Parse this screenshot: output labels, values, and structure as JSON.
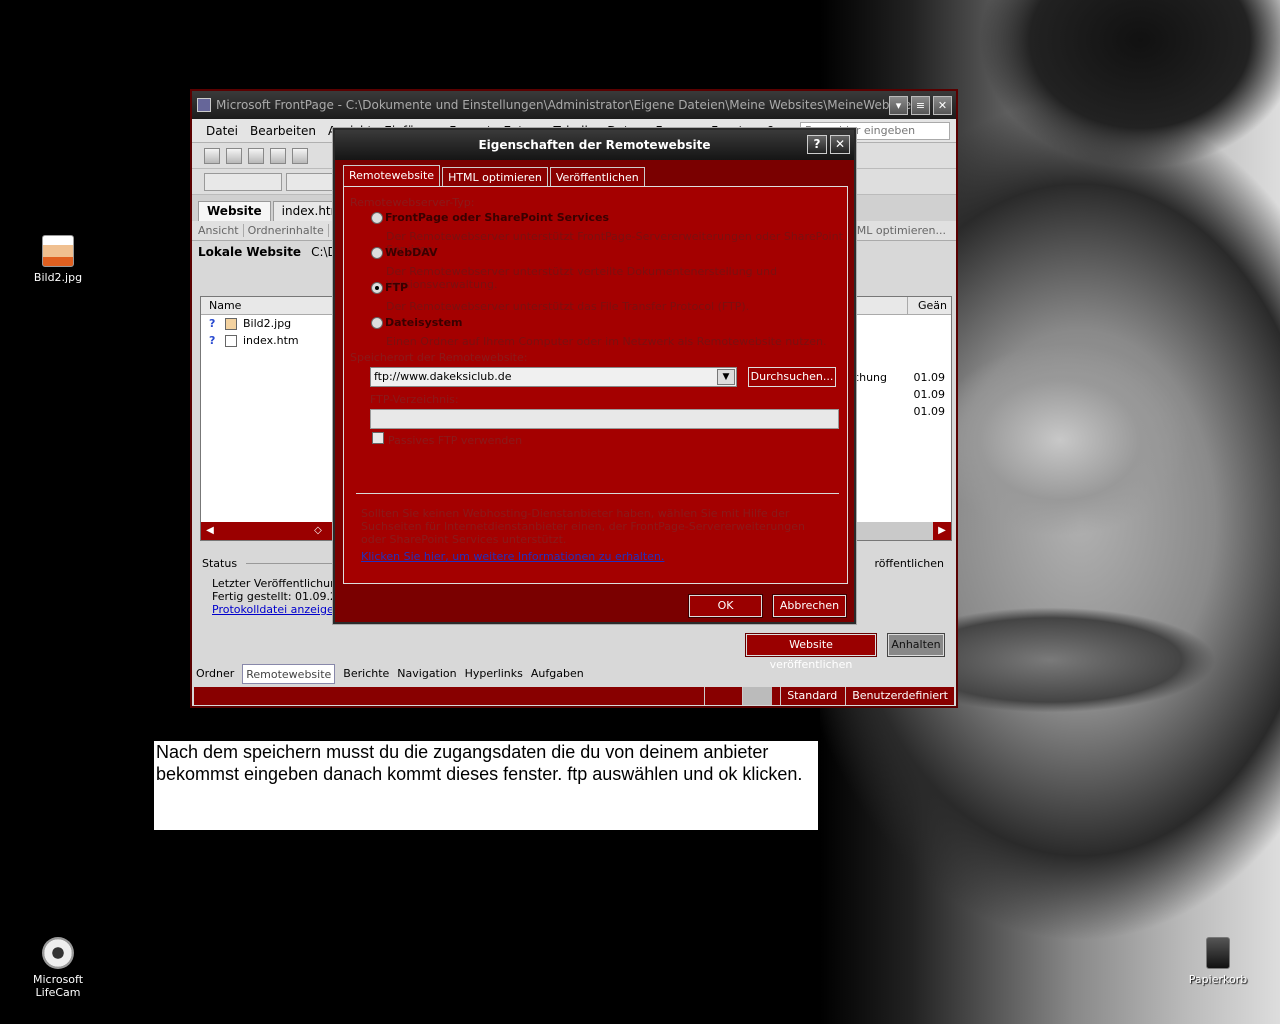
{
  "desktop": {
    "icons": [
      {
        "label": "Bild2.jpg"
      },
      {
        "label": "Microsoft LifeCam"
      },
      {
        "label": "Papierkorb"
      }
    ]
  },
  "frontpage": {
    "title": "Microsoft FrontPage - C:\\Dokumente und Einstellungen\\Administrator\\Eigene Dateien\\Meine Websites\\MeineWebsite",
    "menu": [
      "Datei",
      "Bearbeiten",
      "Ansicht",
      "Einfügen",
      "Format",
      "Extras",
      "Tabelle",
      "Daten",
      "Frames",
      "Fenster",
      "?"
    ],
    "help_placeholder": "Frage hier eingeben",
    "tabs": [
      "Website",
      "index.htm"
    ],
    "view_bar": [
      "Ansicht",
      "Ordnerinhalte",
      "HTML optimieren..."
    ],
    "local_site_label": "Lokale Website",
    "local_site_path": "C:\\Dokumente...",
    "file_header_name": "Name",
    "file_header_right": "Geän",
    "files": [
      {
        "status": "?",
        "name": "Bild2.jpg"
      },
      {
        "status": "?",
        "name": "index.htm"
      }
    ],
    "right_values": [
      "echung",
      "01.09",
      "01.09",
      "01.09"
    ],
    "status_title": "Status",
    "status_lines": [
      "Letzter Veröffentlichungsst",
      "Fertig gestellt: 01.09.200"
    ],
    "log_link": "Protokolldatei anzeigen",
    "publish_label": "röffentlichen",
    "publish_button": "Website veröffentlichen",
    "stop_button": "Anhalten",
    "view_switch": [
      "Ordner",
      "Remotewebsite",
      "Berichte",
      "Navigation",
      "Hyperlinks",
      "Aufgaben"
    ],
    "statusbar": [
      "Standard",
      "Benutzerdefiniert"
    ],
    "window_buttons": [
      "▾",
      "≡",
      "✕"
    ]
  },
  "dialog": {
    "title": "Eigenschaften der Remotewebsite",
    "title_buttons": [
      "?",
      "✕"
    ],
    "tabs": [
      "Remotewebsite",
      "HTML optimieren",
      "Veröffentlichen"
    ],
    "server_type_label": "Remotewebserver-Typ:",
    "options": [
      {
        "label": "FrontPage oder SharePoint Services",
        "desc": "Der Remotewebserver unterstützt FrontPage-Servererweiterungen oder SharePoint Services.",
        "checked": false
      },
      {
        "label": "WebDAV",
        "desc": "Der Remotewebserver unterstützt verteilte Dokumentenerstellung und Versionsverwaltung.",
        "checked": false
      },
      {
        "label": "FTP",
        "desc": "Der Remotewebserver unterstützt das File Transfer Protocol (FTP).",
        "checked": true
      },
      {
        "label": "Dateisystem",
        "desc": "Einen Ordner auf Ihrem Computer oder im Netzwerk als Remotewebsite nutzen.",
        "checked": false
      }
    ],
    "location_label": "Speicherort der Remotewebsite:",
    "location_value": "ftp://www.dakeksiclub.de",
    "browse_button": "Durchsuchen...",
    "ftp_dir_label": "FTP-Verzeichnis:",
    "passive_ftp_label": "Passives FTP verwenden",
    "info_text": "Sollten Sie keinen Webhosting-Dienstanbieter haben, wählen Sie mit Hilfe der Suchseiten für Internetdienstanbieter einen, der FrontPage-Servererweiterungen oder SharePoint Services unterstützt.",
    "info_link": "Klicken Sie hier, um weitere Informationen zu erhalten.",
    "ok_button": "OK",
    "cancel_button": "Abbrechen"
  },
  "caption": {
    "text": "Nach dem speichern musst du die zugangsdaten die du von deinem anbieter bekommst eingeben danach kommt dieses fenster. ftp auswählen und ok klicken."
  }
}
